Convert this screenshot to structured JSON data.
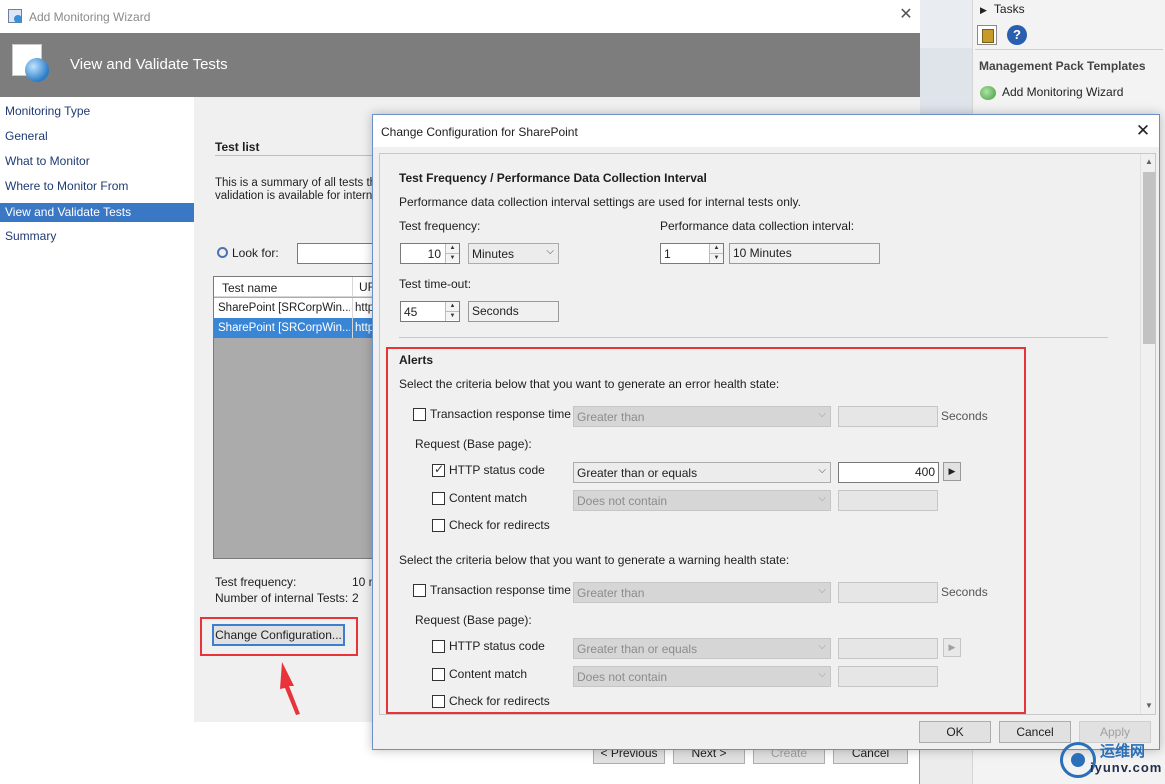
{
  "background_pane": {
    "tasks_label": "Tasks",
    "heading": "Management Pack Templates",
    "item": "Add Monitoring Wizard"
  },
  "wizard": {
    "window_title": "Add Monitoring Wizard",
    "banner_title": "View and Validate Tests",
    "nav": [
      "Monitoring Type",
      "General",
      "What to Monitor",
      "Where to Monitor From",
      "View and Validate Tests",
      "Summary"
    ],
    "selected_nav": "View and Validate Tests",
    "test_list_title": "Test list",
    "desc_line1": "This is a summary of all tests th",
    "desc_line2": "validation is available for interna",
    "look_for_label": "Look for:",
    "grid": {
      "headers": [
        "Test name",
        "UR"
      ],
      "rows": [
        {
          "name": "SharePoint [SRCorpWin...",
          "url": "http",
          "selected": false
        },
        {
          "name": "SharePoint [SRCorpWin...",
          "url": "http",
          "selected": true
        }
      ]
    },
    "summary": {
      "freq_label": "Test frequency:",
      "freq_value": "10 m",
      "count_label": "Number of internal Tests:",
      "count_value": "2"
    },
    "change_config_button": "Change Configuration...",
    "buttons": {
      "previous": "< Previous",
      "next": "Next >",
      "create": "Create",
      "cancel": "Cancel"
    }
  },
  "dialog": {
    "title": "Change Configuration for SharePoint",
    "section1_title": "Test Frequency / Performance Data Collection Interval",
    "section1_desc": "Performance data collection interval settings are used for internal tests only.",
    "test_frequency_label": "Test frequency:",
    "test_frequency_value": "10",
    "test_frequency_unit": "Minutes",
    "perf_interval_label": "Performance data collection interval:",
    "perf_interval_value": "1",
    "perf_interval_display": "10 Minutes",
    "timeout_label": "Test time-out:",
    "timeout_value": "45",
    "timeout_unit": "Seconds",
    "alerts_title": "Alerts",
    "error_criteria_label": "Select the criteria below that you want to generate an error health state:",
    "warning_criteria_label": "Select the criteria below that you want to generate a warning health state:",
    "error": {
      "trt_label": "Transaction response time",
      "trt_op": "Greater than",
      "trt_unit": "Seconds",
      "request_label": "Request (Base page):",
      "http_label": "HTTP status code",
      "http_op": "Greater than or equals",
      "http_value": "400",
      "content_label": "Content match",
      "content_op": "Does not contain",
      "redirect_label": "Check for redirects"
    },
    "warning": {
      "trt_label": "Transaction response time",
      "trt_op": "Greater than",
      "trt_unit": "Seconds",
      "request_label": "Request (Base page):",
      "http_label": "HTTP status code",
      "http_op": "Greater than or equals",
      "content_label": "Content match",
      "content_op": "Does not contain",
      "redirect_label": "Check for redirects"
    },
    "buttons": {
      "ok": "OK",
      "cancel": "Cancel",
      "apply": "Apply"
    }
  },
  "watermark": {
    "cn_text": "运维网",
    "brand": "iyunv.com"
  },
  "colors": {
    "banner": "#7d7d7d",
    "selection": "#3a77c4",
    "highlight_red": "#e8333a",
    "dialog_border": "#6b8fc9"
  }
}
